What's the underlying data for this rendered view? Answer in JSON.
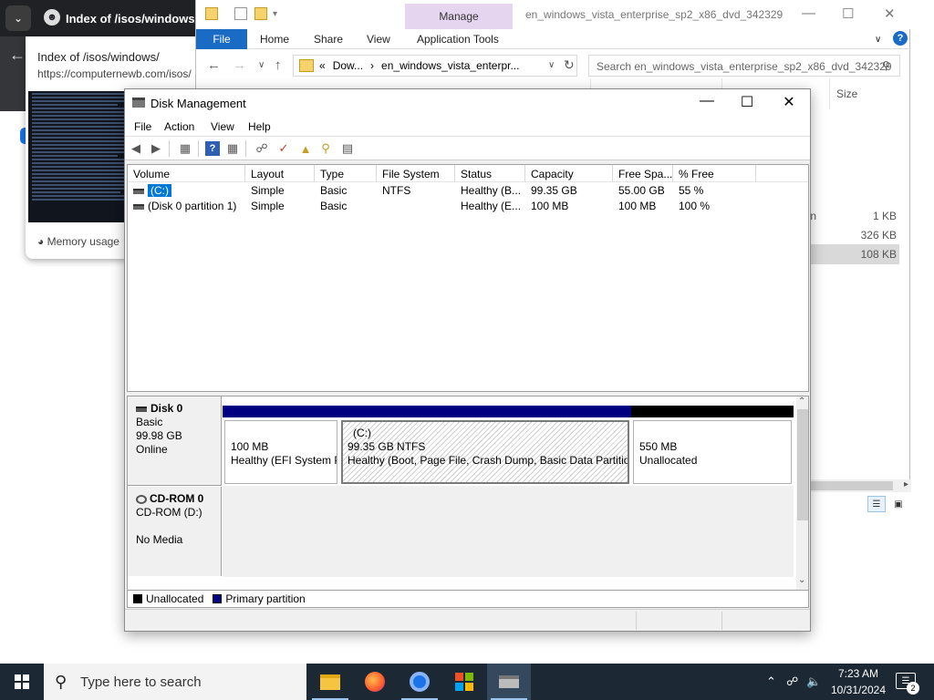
{
  "browser": {
    "tab_title": "Index of /isos/windows/",
    "popup_title": "Index of /isos/windows/",
    "popup_url": "https://computernewb.com/isos/",
    "popup_memory": "Memory usage"
  },
  "explorer": {
    "manage_tab": "Manage",
    "window_title": "en_windows_vista_enterprise_sp2_x86_dvd_342329",
    "ribbon": {
      "file": "File",
      "home": "Home",
      "share": "Share",
      "view": "View",
      "application_tools": "Application Tools"
    },
    "address": {
      "prefix": "«",
      "part1": "Dow...",
      "sep": "›",
      "part2": "en_windows_vista_enterpr..."
    },
    "search_placeholder": "Search en_windows_vista_enterprise_sp2_x86_dvd_342329",
    "size_header": "Size",
    "fragment": "n",
    "file_sizes": [
      "1 KB",
      "326 KB",
      "108 KB"
    ]
  },
  "disk_management": {
    "title": "Disk Management",
    "menu": [
      "File",
      "Action",
      "View",
      "Help"
    ],
    "columns": [
      "Volume",
      "Layout",
      "Type",
      "File System",
      "Status",
      "Capacity",
      "Free Spa...",
      "% Free"
    ],
    "volumes": [
      {
        "volume": "(C:)",
        "layout": "Simple",
        "type": "Basic",
        "fs": "NTFS",
        "status": "Healthy (B...",
        "capacity": "99.35 GB",
        "free": "55.00 GB",
        "pct": "55 %"
      },
      {
        "volume": "(Disk 0 partition 1)",
        "layout": "Simple",
        "type": "Basic",
        "fs": "",
        "status": "Healthy (E...",
        "capacity": "100 MB",
        "free": "100 MB",
        "pct": "100 %"
      }
    ],
    "disk0": {
      "name": "Disk 0",
      "type": "Basic",
      "size": "99.98 GB",
      "state": "Online",
      "partitions": [
        {
          "title": "",
          "line1": "100 MB",
          "line2": "Healthy (EFI System P"
        },
        {
          "title": "(C:)",
          "line1": "99.35 GB NTFS",
          "line2": "Healthy (Boot, Page File, Crash Dump, Basic Data Partition"
        },
        {
          "title": "",
          "line1": "550 MB",
          "line2": "Unallocated"
        }
      ]
    },
    "cdrom": {
      "name": "CD-ROM 0",
      "drive": "CD-ROM (D:)",
      "media": "No Media"
    },
    "legend": {
      "unallocated": "Unallocated",
      "primary": "Primary partition"
    },
    "colors": {
      "primary": "#000080",
      "unallocated": "#000000",
      "selection": "#0078d7"
    }
  },
  "taskbar": {
    "search_placeholder": "Type here to search",
    "time": "7:23 AM",
    "date": "10/31/2024",
    "notifications": "2"
  }
}
